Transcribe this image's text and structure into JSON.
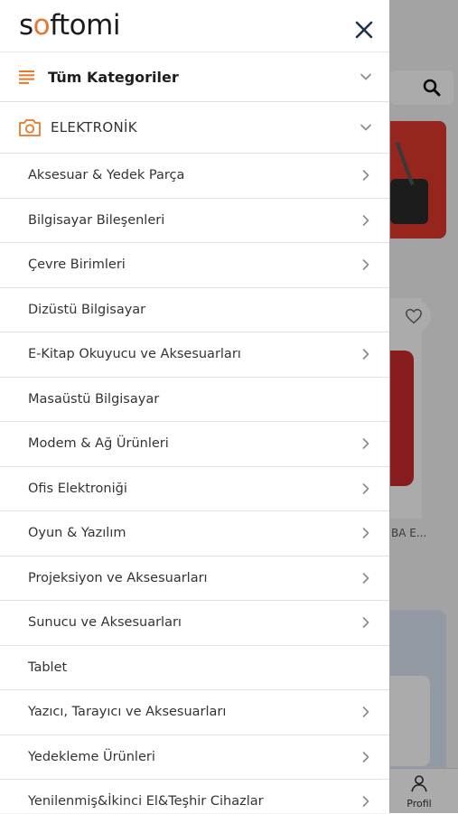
{
  "app": {
    "logo_text_start": "s",
    "logo_text_mark": "o",
    "logo_text_end": "ftomi"
  },
  "colors": {
    "accent": "#e8762c",
    "text": "#333333",
    "divider": "#e2e2e2",
    "overlay": "rgba(0,0,0,0.33)"
  },
  "drawer": {
    "close_icon": "close-icon",
    "all_categories": {
      "label": "Tüm Kategoriler",
      "icon": "list-icon"
    },
    "section": {
      "label": "ELEKTRONİK",
      "icon": "camera-icon"
    },
    "items": [
      {
        "label": "Aksesuar & Yedek Parça",
        "has_children": true
      },
      {
        "label": "Bilgisayar Bileşenleri",
        "has_children": true
      },
      {
        "label": "Çevre Birimleri",
        "has_children": true
      },
      {
        "label": "Dizüstü Bilgisayar",
        "has_children": false
      },
      {
        "label": "E-Kitap Okuyucu ve Aksesuarları",
        "has_children": true
      },
      {
        "label": "Masaüstü Bilgisayar",
        "has_children": false
      },
      {
        "label": "Modem & Ağ Ürünleri",
        "has_children": true
      },
      {
        "label": "Ofis Elektroniği",
        "has_children": true
      },
      {
        "label": "Oyun & Yazılım",
        "has_children": true
      },
      {
        "label": "Projeksiyon ve Aksesuarları",
        "has_children": true
      },
      {
        "label": "Sunucu ve Aksesuarları",
        "has_children": true
      },
      {
        "label": "Tablet",
        "has_children": false
      },
      {
        "label": "Yazıcı, Tarayıcı ve Aksesuarları",
        "has_children": true
      },
      {
        "label": "Yedekleme Ürünleri",
        "has_children": true
      },
      {
        "label": "Yenilenmiş&İkinci El&Teşhir Cihazlar",
        "has_children": true
      }
    ]
  },
  "background": {
    "product_title_fragment": "BA E...",
    "tabbar": {
      "profile_label": "Profil"
    }
  }
}
